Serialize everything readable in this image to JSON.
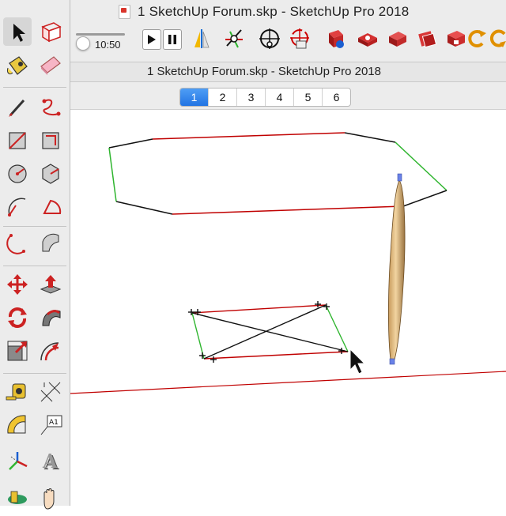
{
  "window": {
    "title": "1 SketchUp Forum.skp - SketchUp Pro 2018"
  },
  "animation": {
    "time": "10:50",
    "play_icon": "play-icon",
    "pause_icon": "pause-icon"
  },
  "document": {
    "title": "1 SketchUp Forum.skp - SketchUp Pro 2018"
  },
  "scenes": {
    "tabs": [
      "1",
      "2",
      "3",
      "4",
      "5",
      "6"
    ],
    "active": "1"
  },
  "top_toolbar_icons": [
    "section-plane-icon",
    "axes-icon",
    "compass-icon",
    "position-camera-icon",
    "look-around-icon",
    "add-location-icon",
    "get-models-icon",
    "share-model-icon",
    "extension-warehouse-icon",
    "layout-icon",
    "extension-manager-icon",
    "orbit-arrow-icon",
    "undo-arc-icon"
  ],
  "left_toolbar_tools": [
    "select-icon",
    "make-component-icon",
    "paint-bucket-icon",
    "eraser-icon",
    "line-icon",
    "freehand-icon",
    "rectangle-icon",
    "rotated-rectangle-icon",
    "circle-icon",
    "polygon-icon",
    "arc-icon",
    "pie-icon",
    "two-point-arc-icon",
    "three-point-arc-icon",
    "move-icon",
    "push-pull-icon",
    "rotate-icon",
    "follow-me-icon",
    "scale-icon",
    "offset-icon",
    "tape-measure-icon",
    "dimension-icon",
    "protractor-icon",
    "text-icon",
    "axes-icon",
    "3d-text-icon",
    "section-plane-icon",
    "pan-hand-icon"
  ],
  "colors": {
    "accent": "#2274e3",
    "axis_red": "#c00000",
    "axis_green": "#2fb52f",
    "edge": "#111111"
  }
}
